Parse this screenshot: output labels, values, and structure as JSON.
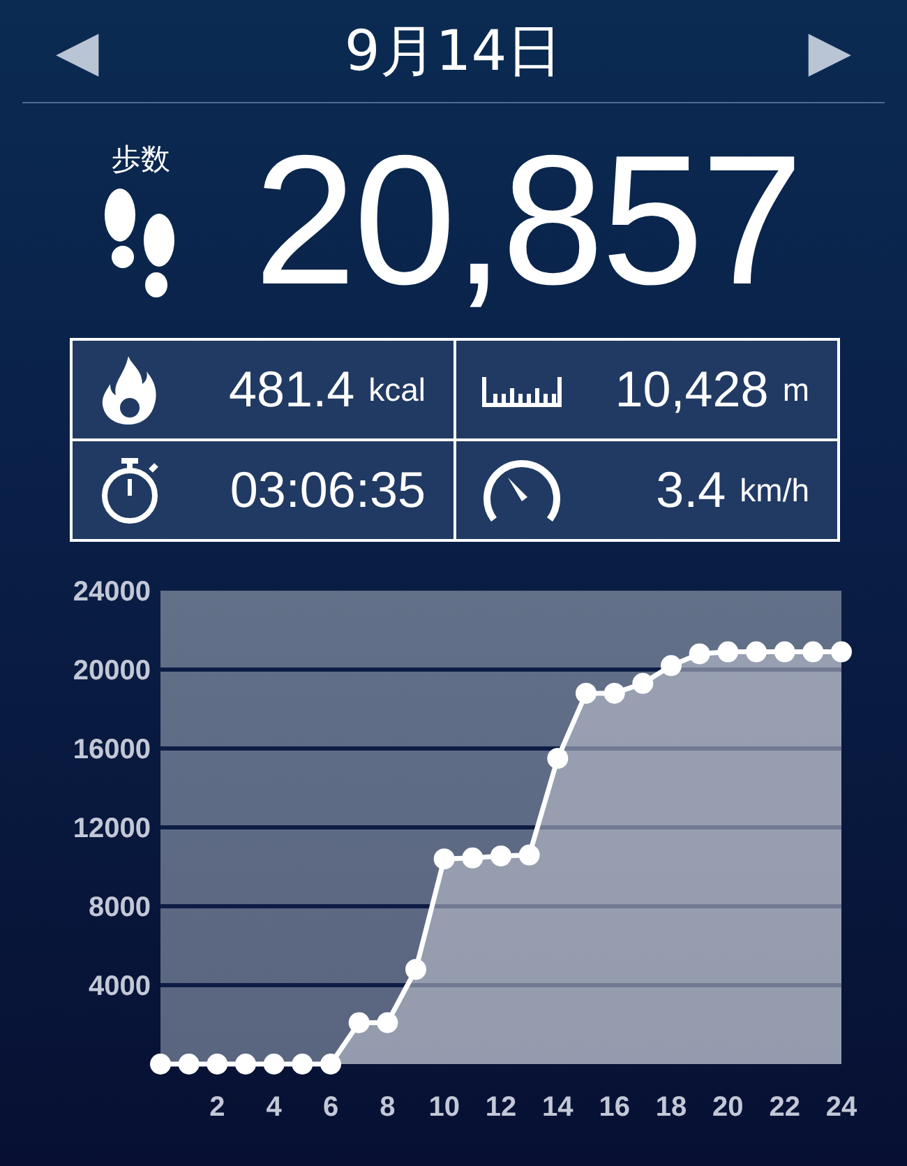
{
  "header": {
    "title": "9月14日",
    "prev_label": "◀",
    "next_label": "▶"
  },
  "steps": {
    "label": "歩数",
    "value": "20,857"
  },
  "stats": [
    {
      "kind": "calories",
      "value": "481.4",
      "unit": "kcal"
    },
    {
      "kind": "distance",
      "value": "10,428",
      "unit": "m"
    },
    {
      "kind": "duration",
      "value": "03:06:35"
    },
    {
      "kind": "speed",
      "value": "3.4",
      "unit": "km/h"
    }
  ],
  "chart": {
    "chart_data": {
      "type": "area",
      "x": [
        0,
        1,
        2,
        3,
        4,
        5,
        6,
        7,
        8,
        9,
        10,
        11,
        12,
        13,
        14,
        15,
        16,
        17,
        18,
        19,
        20,
        21,
        22,
        23,
        24
      ],
      "grid": true,
      "series": [
        {
          "color": "#ffffff",
          "values": [
            0,
            0,
            0,
            0,
            0,
            0,
            0,
            2100,
            2100,
            4800,
            10400,
            10450,
            10550,
            10600,
            15500,
            18800,
            18800,
            19300,
            20200,
            20800,
            20900,
            20900,
            20900,
            20900,
            20900
          ]
        }
      ],
      "xlim": [
        0,
        24
      ],
      "ylim": [
        0,
        24000
      ],
      "xticks": [
        2,
        4,
        6,
        8,
        10,
        12,
        14,
        16,
        18,
        20,
        22,
        24
      ],
      "yticks": [
        4000,
        8000,
        12000,
        16000,
        20000,
        24000
      ]
    }
  }
}
